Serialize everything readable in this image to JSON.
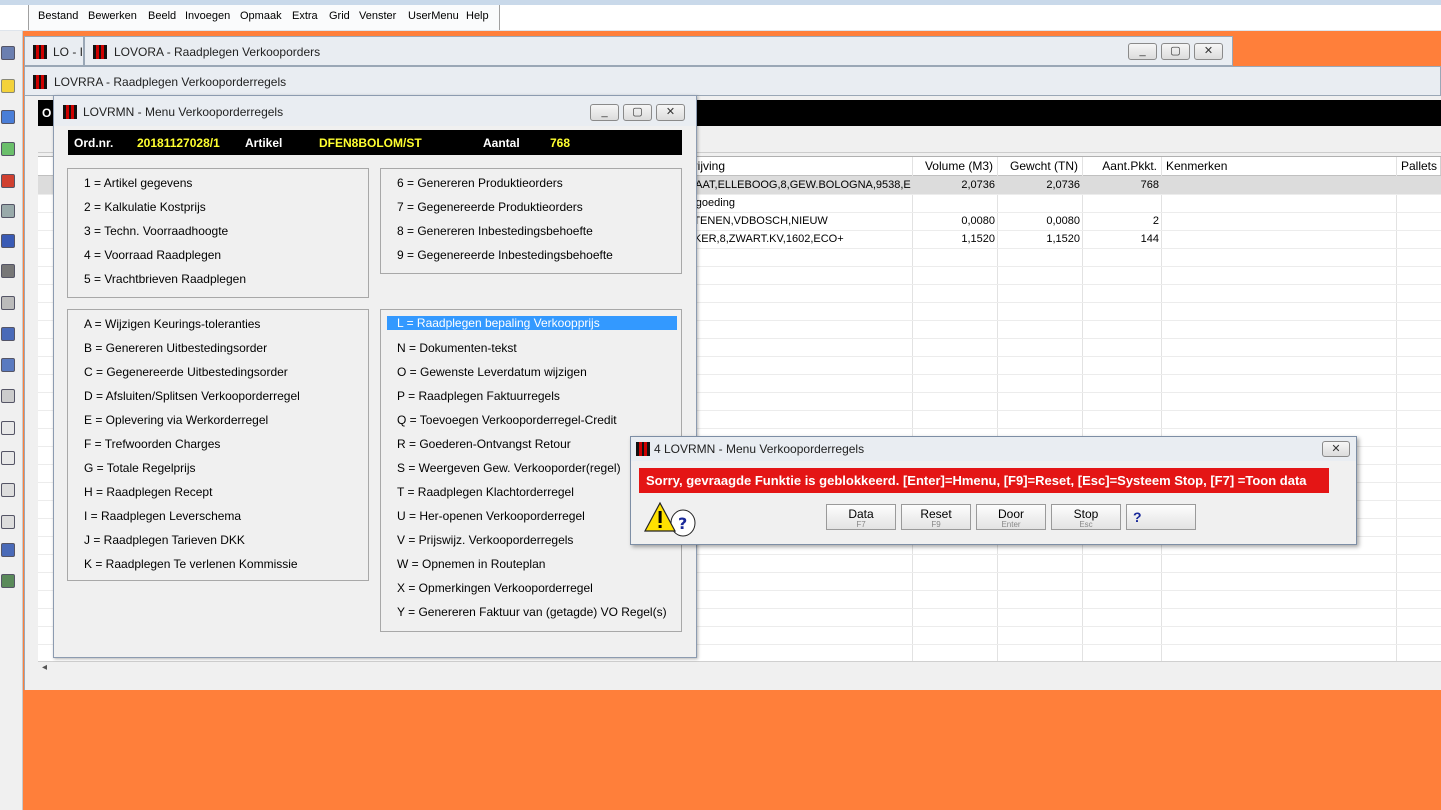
{
  "menubar": [
    "Bestand",
    "Bewerken",
    "Beeld",
    "Invoegen",
    "Opmaak",
    "Extra",
    "Grid",
    "Venster",
    "UserMenu",
    "Help"
  ],
  "windows": {
    "lo_title": "LO - I",
    "lovora_title": "LOVORA - Raadplegen Verkooporders",
    "lovrra_title": "LOVRRA - Raadplegen Verkooporderregels",
    "blackbar_char": "O"
  },
  "grid": {
    "headers": [
      "hrijving",
      "Volume (M3)",
      "Gewcht (TN)",
      "Aant.Pkkt.",
      "Kenmerken",
      "Pallets"
    ],
    "rows": [
      {
        "desc": "MAAT,ELLEBOOG,8,GEW.BOLOGNA,9538,E",
        "volume": "2,0736",
        "gewicht": "2,0736",
        "aant": "768"
      },
      {
        "desc": "ergoeding",
        "volume": "",
        "gewicht": "",
        "aant": ""
      },
      {
        "desc": "STENEN,VDBOSCH,NIEUW",
        "volume": "0,0080",
        "gewicht": "0,0080",
        "aant": "2"
      },
      {
        "desc": "NKER,8,ZWART.KV,1602,ECO+",
        "volume": "1,1520",
        "gewicht": "1,1520",
        "aant": "144"
      }
    ]
  },
  "menuwin": {
    "title": "LOVRMN - Menu Verkooporderregels",
    "ord_label": "Ord.nr.",
    "ord_value": "20181127028/1",
    "art_label": "Artikel",
    "art_value": "DFEN8BOLOM/ST",
    "aantal_label": "Aantal",
    "aantal_value": "768",
    "group1": [
      "1 = Artikel gegevens",
      "2 = Kalkulatie Kostprijs",
      "3 = Techn. Voorraadhoogte",
      "4 = Voorraad Raadplegen",
      "5 = Vrachtbrieven Raadplegen"
    ],
    "group2": [
      "6 = Genereren Produktieorders",
      "7 = Gegenereerde Produktieorders",
      "8 = Genereren Inbestedingsbehoefte",
      "9 = Gegenereerde Inbestedingsbehoefte"
    ],
    "group3": [
      "A = Wijzigen Keurings-toleranties",
      "B = Genereren Uitbestedingsorder",
      "C = Gegenereerde Uitbestedingsorder",
      "D = Afsluiten/Splitsen Verkooporderregel",
      "E = Oplevering via Werkorderregel",
      "F = Trefwoorden Charges",
      "G = Totale Regelprijs",
      "H = Raadplegen Recept",
      "I = Raadplegen Leverschema",
      "J = Raadplegen Tarieven DKK",
      "K = Raadplegen Te verlenen Kommissie"
    ],
    "group4": [
      "L = Raadplegen bepaling Verkoopprijs",
      "N = Dokumenten-tekst",
      "O = Gewenste Leverdatum wijzigen",
      "P = Raadplegen Faktuurregels",
      "Q = Toevoegen Verkooporderregel-Credit",
      "R = Goederen-Ontvangst Retour",
      "S = Weergeven Gew. Verkooporder(regel)",
      "T = Raadplegen Klachtorderregel",
      "U = Her-openen Verkooporderregel",
      "V = Prijswijz. Verkooporderregels",
      "W = Opnemen in Routeplan",
      "X = Opmerkingen Verkooporderregel",
      "Y = Genereren Faktuur van (getagde) VO Regel(s)"
    ]
  },
  "dialog": {
    "title": "4 LOVRMN - Menu Verkooporderregels",
    "message": "Sorry, gevraagde Funktie is geblokkeerd.  [Enter]=Hmenu, [F9]=Reset, [Esc]=Systeem Stop, [F7] =Toon data",
    "buttons": [
      {
        "label": "Data",
        "key": "F7"
      },
      {
        "label": "Reset",
        "key": "F9"
      },
      {
        "label": "Door",
        "key": "Enter"
      },
      {
        "label": "Stop",
        "key": "Esc"
      }
    ],
    "help_glyph": "?"
  },
  "colors": {
    "desktop": "#ff7f3a",
    "error": "#e41515",
    "selected": "#3399ff",
    "info_value": "#ffff30"
  }
}
